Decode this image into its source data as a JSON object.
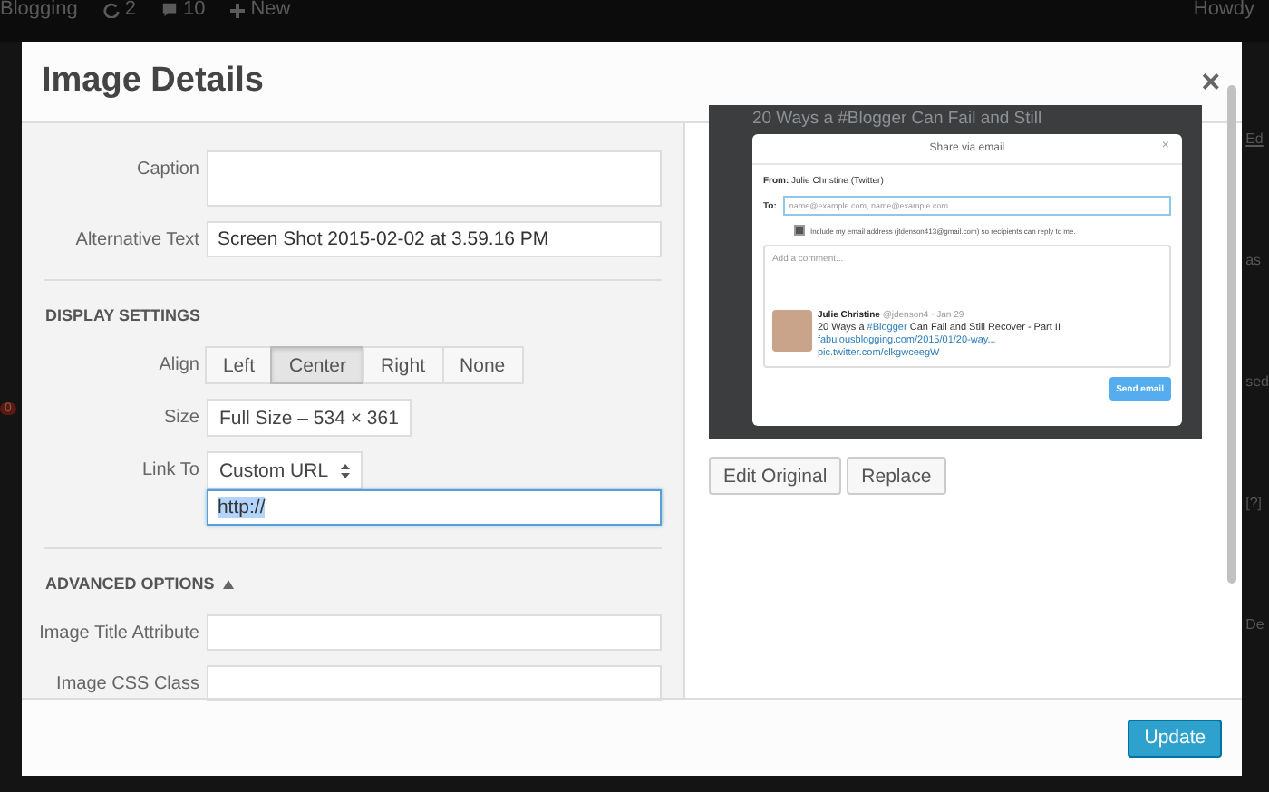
{
  "background": {
    "admin_bar": [
      {
        "kind": "site",
        "label": "Blogging"
      },
      {
        "kind": "updates",
        "label": "2"
      },
      {
        "kind": "comments",
        "label": "10"
      },
      {
        "kind": "new",
        "label": "New"
      }
    ],
    "greeting": "Howdy",
    "badge": "0",
    "side_fragments": [
      "Ed",
      "as",
      "sed",
      "[?]",
      "De"
    ]
  },
  "dialog": {
    "title": "Image Details",
    "close": "×",
    "fields": [
      {
        "kind": "textarea",
        "label": "Caption"
      },
      {
        "kind": "text",
        "label": "Alternative Text",
        "value": "Screen Shot 2015-02-02 at 3.59.16 PM"
      }
    ],
    "display_settings": {
      "heading": "DISPLAY SETTINGS",
      "align": {
        "label": "Align",
        "options": [
          {
            "label": "Left",
            "selected": false
          },
          {
            "label": "Center",
            "selected": true
          },
          {
            "label": "Right",
            "selected": false
          },
          {
            "label": "None",
            "selected": false
          }
        ]
      },
      "size": {
        "label": "Size",
        "value": "Full Size – 534 × 361"
      },
      "link_to": {
        "label": "Link To",
        "value": "Custom URL"
      },
      "url": {
        "value": "http://",
        "highlighted": true
      }
    },
    "advanced_options": {
      "heading": "ADVANCED OPTIONS",
      "expanded": true,
      "fields": [
        {
          "label": "Image Title Attribute"
        },
        {
          "label": "Image CSS Class"
        }
      ]
    },
    "preview": {
      "page_heading": "20 Ways a #Blogger Can Fail and Still",
      "share": {
        "title": "Share via email",
        "close": "×",
        "from": "**From:** Julie Christine (Twitter)",
        "to_label": "To:",
        "to_placeholder": "name@example.com, name@example.com",
        "include_checked": true,
        "include_text": "Include my email address (jtdenson413@gmail.com) so recipients can reply to me.",
        "comment_placeholder": "Add a comment...",
        "tweet": {
          "author": "Julie Christine",
          "meta": "@jdenson4 · Jan 29",
          "text": [
            {
              "kind": "plain",
              "text": "20 Ways a "
            },
            {
              "kind": "hashtag",
              "text": "#Blogger"
            },
            {
              "kind": "plain",
              "text": " Can Fail and Still Recover - Part II"
            }
          ],
          "links": [
            "fabulousblogging.com/2015/01/20-way...",
            "pic.twitter.com/clkgwceegW"
          ]
        },
        "send": "Send email"
      }
    },
    "preview_buttons": [
      "Edit Original",
      "Replace"
    ],
    "update": "Update"
  }
}
